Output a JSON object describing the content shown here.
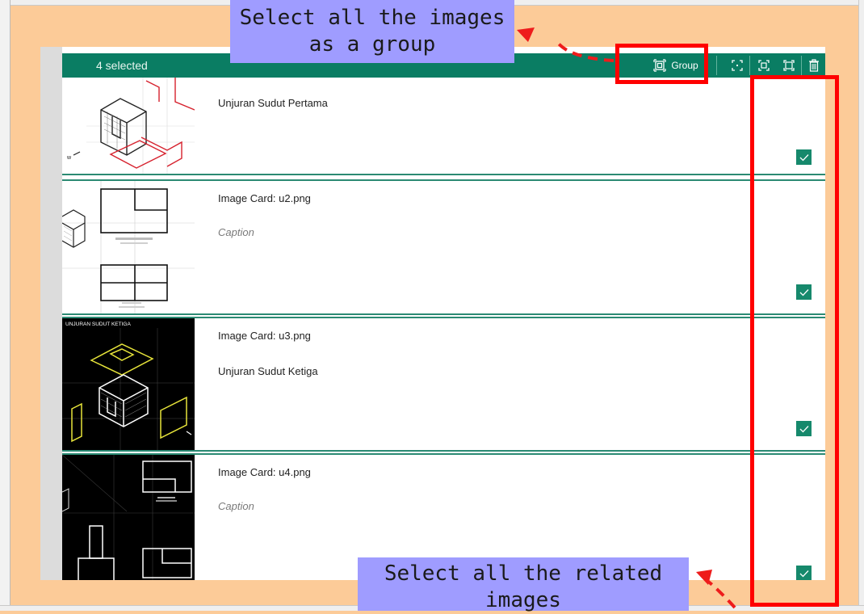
{
  "selection_bar": {
    "count_label": "4 selected",
    "group_label": "Group",
    "icons": [
      "group-icon",
      "focus-icon",
      "fit-icon",
      "expand-icon",
      "trash-icon"
    ]
  },
  "cards": [
    {
      "title": "Unjuran Sudut Pertama",
      "caption": "",
      "checked": true
    },
    {
      "title": "Image Card: u2.png",
      "caption": "Caption",
      "caption_is_placeholder": true,
      "checked": true
    },
    {
      "title": "Image Card: u3.png",
      "caption": "Unjuran Sudut Ketiga",
      "caption_is_placeholder": false,
      "checked": true
    },
    {
      "title": "Image Card: u4.png",
      "caption": "Caption",
      "caption_is_placeholder": true,
      "checked": true
    }
  ],
  "thumbnails": {
    "u3_header": "UNJURAN SUDUT KETIGA"
  },
  "callouts": {
    "group": "Select all the images as a group",
    "select": "Select all the related images"
  },
  "colors": {
    "accent": "#0a7d63",
    "highlight": "#ff0000",
    "callout_bg": "#9f9cff",
    "slide_bg": "#fccb98"
  }
}
